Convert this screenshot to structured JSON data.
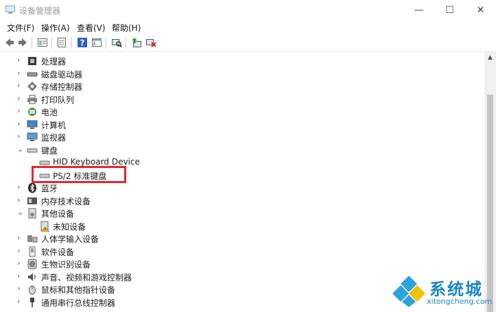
{
  "window": {
    "title": "设备管理器",
    "minimize_glyph": "—",
    "maximize_glyph": "☐",
    "close_glyph": "✕"
  },
  "menu": [
    "文件(F)",
    "操作(A)",
    "查看(V)",
    "帮助(H)"
  ],
  "toolbar_icons": [
    "back-icon",
    "forward-icon",
    "properties-icon",
    "driver-details-icon",
    "help-icon",
    "view-icon",
    "scan-hardware-icon",
    "update-driver-icon",
    "disable-device-icon"
  ],
  "tree": [
    {
      "label": "处理器",
      "state": "collapsed",
      "icon": "processor-icon",
      "level": 0
    },
    {
      "label": "磁盘驱动器",
      "state": "collapsed",
      "icon": "disk-drive-icon",
      "level": 0
    },
    {
      "label": "存储控制器",
      "state": "collapsed",
      "icon": "storage-controller-icon",
      "level": 0
    },
    {
      "label": "打印队列",
      "state": "collapsed",
      "icon": "printer-icon",
      "level": 0
    },
    {
      "label": "电池",
      "state": "collapsed",
      "icon": "battery-icon",
      "level": 0
    },
    {
      "label": "计算机",
      "state": "collapsed",
      "icon": "computer-icon",
      "level": 0
    },
    {
      "label": "监视器",
      "state": "collapsed",
      "icon": "monitor-icon",
      "level": 0
    },
    {
      "label": "键盘",
      "state": "expanded",
      "icon": "keyboard-icon",
      "level": 0
    },
    {
      "label": "HID Keyboard Device",
      "state": "leaf",
      "icon": "keyboard-icon",
      "level": 1
    },
    {
      "label": "PS/2 标准键盘",
      "state": "leaf",
      "icon": "keyboard-icon",
      "level": 1,
      "highlighted": true
    },
    {
      "label": "蓝牙",
      "state": "collapsed",
      "icon": "bluetooth-icon",
      "level": 0
    },
    {
      "label": "内存技术设备",
      "state": "collapsed",
      "icon": "memory-icon",
      "level": 0
    },
    {
      "label": "其他设备",
      "state": "expanded",
      "icon": "other-devices-icon",
      "level": 0
    },
    {
      "label": "未知设备",
      "state": "leaf",
      "icon": "unknown-device-warning-icon",
      "level": 1
    },
    {
      "label": "人体学输入设备",
      "state": "collapsed",
      "icon": "hid-icon",
      "level": 0
    },
    {
      "label": "软件设备",
      "state": "collapsed",
      "icon": "software-device-icon",
      "level": 0
    },
    {
      "label": "生物识别设备",
      "state": "collapsed",
      "icon": "biometric-icon",
      "level": 0
    },
    {
      "label": "声音、视频和游戏控制器",
      "state": "collapsed",
      "icon": "sound-icon",
      "level": 0
    },
    {
      "label": "鼠标和其他指针设备",
      "state": "collapsed",
      "icon": "mouse-icon",
      "level": 0
    },
    {
      "label": "通用串行总线控制器",
      "state": "collapsed",
      "icon": "usb-icon",
      "level": 0
    }
  ],
  "watermark": {
    "brand": "系统城",
    "url": "xitongcheng.com"
  },
  "colors": {
    "highlight": "#e8232d",
    "watermark": "#1a84c6"
  }
}
